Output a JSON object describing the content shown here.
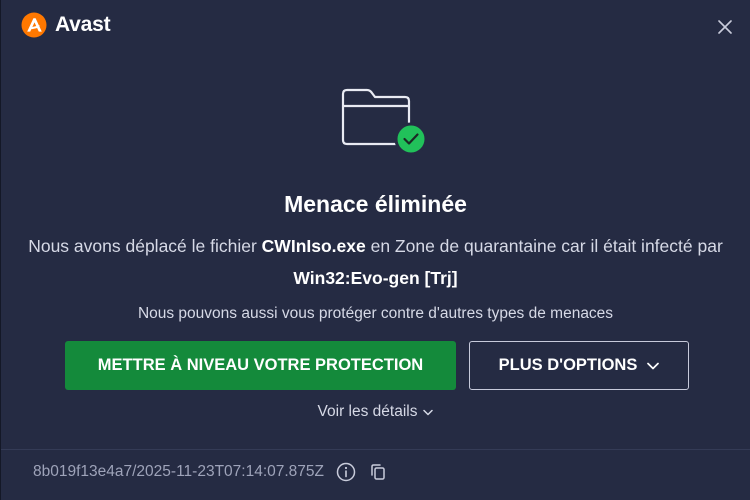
{
  "app": {
    "brand_name": "Avast",
    "colors": {
      "background": "#252b43",
      "brand_orange": "#ff7800",
      "success_green": "#148a3b",
      "check_green": "#21c15a"
    }
  },
  "header": {
    "close_icon": "close-icon"
  },
  "hero": {
    "icon": "folder-with-checkmark-icon"
  },
  "content": {
    "title": "Menace éliminée",
    "message_part1": "Nous avons déplacé le fichier ",
    "file_name": "CWInIso.exe",
    "message_part2": " en Zone de quarantaine car il était infecté par ",
    "threat_name": "Win32:Evo-gen [Trj]",
    "subtext": "Nous pouvons aussi vous protéger contre d'autres types de menaces"
  },
  "actions": {
    "primary_label": "METTRE À NIVEAU VOTRE PROTECTION",
    "secondary_label": "PLUS D'OPTIONS",
    "details_label": "Voir les détails"
  },
  "footer": {
    "id_text": "8b019f13e4a7/2025-11-23T07:14:07.875Z",
    "info_icon": "info-icon",
    "copy_icon": "copy-icon"
  }
}
